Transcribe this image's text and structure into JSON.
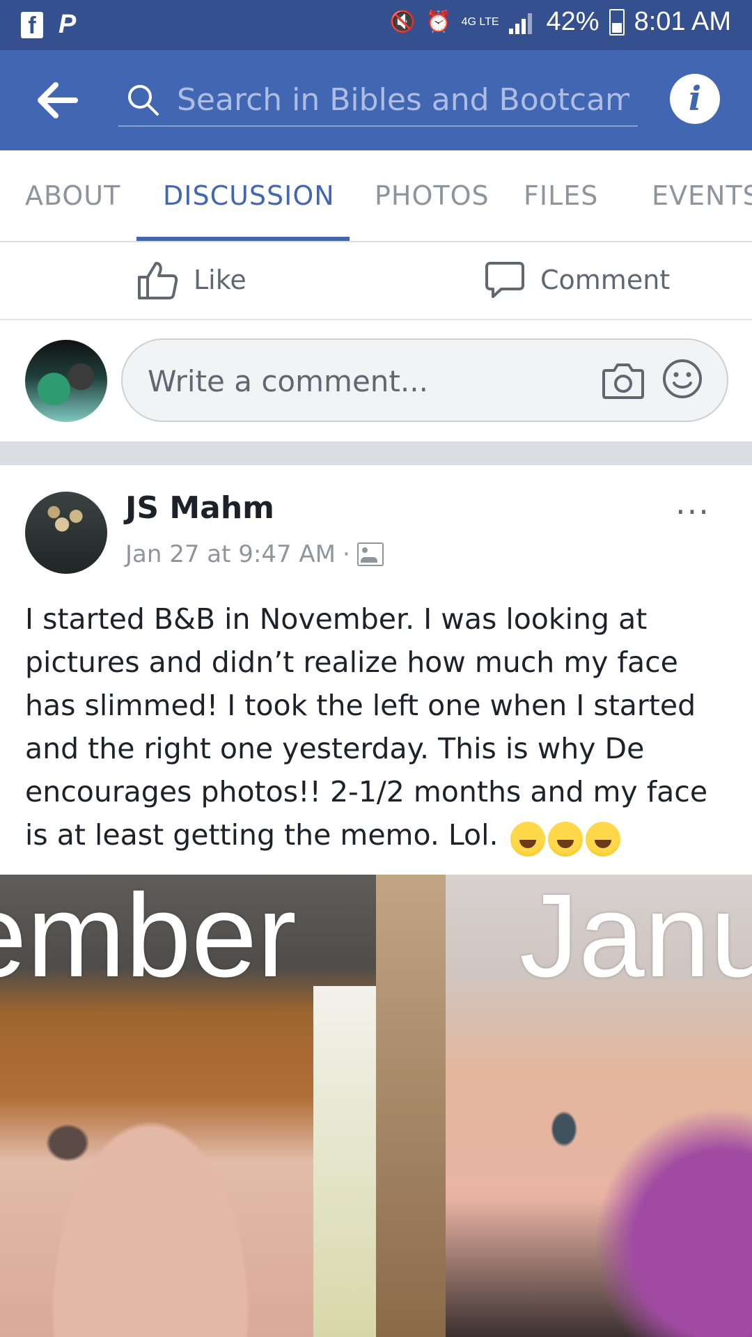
{
  "status_bar": {
    "apps": [
      "facebook-icon",
      "paypal-icon"
    ],
    "network": "4G LTE",
    "battery": "42%",
    "time": "8:01 AM"
  },
  "header": {
    "search_placeholder": "Search in Bibles and Bootcamp",
    "colors": {
      "bar": "#4267b2",
      "status": "#34508f"
    }
  },
  "tabs": [
    {
      "label": "ABOUT",
      "active": false
    },
    {
      "label": "DISCUSSION",
      "active": true
    },
    {
      "label": "PHOTOS",
      "active": false
    },
    {
      "label": "FILES",
      "active": false
    },
    {
      "label": "EVENTS",
      "active": false
    }
  ],
  "actions": {
    "like": "Like",
    "comment": "Comment"
  },
  "composer": {
    "placeholder": "Write a comment..."
  },
  "post": {
    "author": "JS Mahm",
    "timestamp": "Jan 27 at 9:47 AM",
    "separator": "·",
    "more": "···",
    "text": "I started B&B in November. I was looking at pictures and didn’t realize how much my face has slimmed! I took the left one when I started and the right one yesterday. This is why De encourages photos!! 2-1/2 months and my face is at least getting the memo. Lol.",
    "emojis": [
      "rofl-emoji",
      "joy-emoji",
      "rofl-emoji"
    ],
    "photo": {
      "left_label": "ember",
      "right_label": "Janu"
    }
  }
}
